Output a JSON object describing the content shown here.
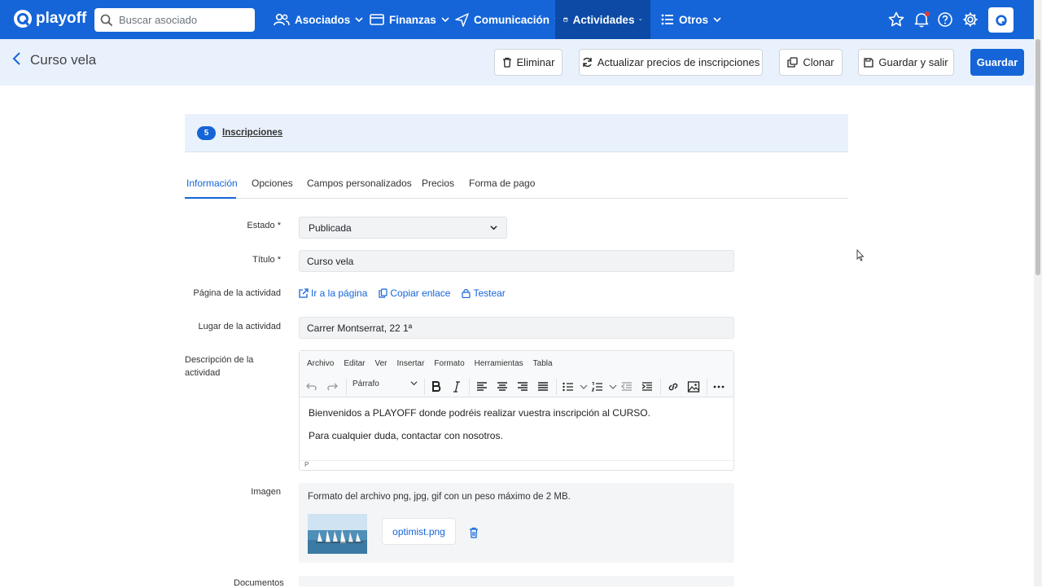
{
  "nav": {
    "brand": "playoff",
    "search_placeholder": "Buscar asociado",
    "items": [
      {
        "label": "Asociados",
        "icon": "users-icon"
      },
      {
        "label": "Finanzas",
        "icon": "wallet-icon"
      },
      {
        "label": "Comunicación",
        "icon": "send-icon"
      },
      {
        "label": "Actividades",
        "icon": "calendar-icon",
        "active": true
      },
      {
        "label": "Otros",
        "icon": "list-icon"
      }
    ],
    "right_icons": [
      "star-icon",
      "bell-icon",
      "help-icon",
      "gear-icon",
      "user-logo-icon"
    ],
    "accent_color": "#1565d8"
  },
  "header": {
    "title": "Curso vela",
    "buttons": {
      "delete": "Eliminar",
      "update_prices": "Actualizar precios de inscripciones",
      "clone": "Clonar",
      "save_exit": "Guardar y salir",
      "save": "Guardar"
    }
  },
  "inscripciones": {
    "count": "5",
    "label": "Inscripciones"
  },
  "tabs": [
    "Información",
    "Opciones",
    "Campos personalizados",
    "Precios",
    "Forma de pago"
  ],
  "form": {
    "estado_label": "Estado *",
    "estado_value": "Publicada",
    "titulo_label": "Título *",
    "titulo_value": "Curso vela",
    "pagina_label": "Página de la actividad",
    "pagina_links": {
      "go": "Ir a la página",
      "copy": "Copiar enlace",
      "test": "Testear"
    },
    "lugar_label": "Lugar de la actividad",
    "lugar_value": "Carrer Montserrat, 22 1ª",
    "descripcion_label": "Descripción de la actividad",
    "editor": {
      "menu": [
        "Archivo",
        "Editar",
        "Ver",
        "Insertar",
        "Formato",
        "Herramientas",
        "Tabla"
      ],
      "block_format": "Párrafo",
      "paragraphs": [
        "Bienvenidos a PLAYOFF donde podréis realizar vuestra inscripción al CURSO.",
        "Para cualquier duda, contactar con nosotros."
      ],
      "status": "P"
    },
    "imagen_label": "Imagen",
    "imagen_hint": "Formato del archivo png, jpg, gif con un peso máximo de 2 MB.",
    "imagen_file": "optimist.png",
    "documentos_label": "Documentos"
  }
}
